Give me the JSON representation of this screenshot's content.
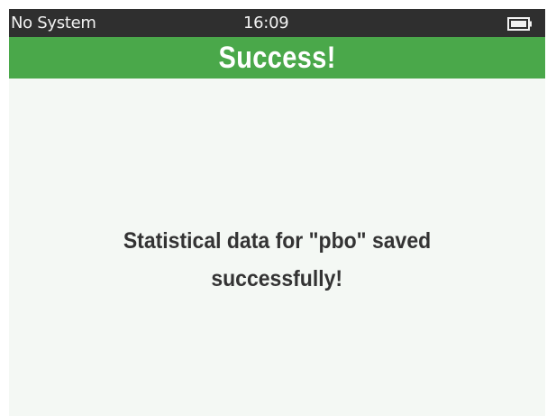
{
  "status_bar": {
    "system": "No System",
    "time": "16:09",
    "battery_icon": "battery-full-icon"
  },
  "header": {
    "title": "Success!"
  },
  "message": {
    "line1": "Statistical data for \"pbo\" saved",
    "line2": "successfully!"
  },
  "colors": {
    "status_bar": "#2f2f2f",
    "header": "#4aa84a",
    "background": "#f4f8f4",
    "text": "#333333"
  }
}
